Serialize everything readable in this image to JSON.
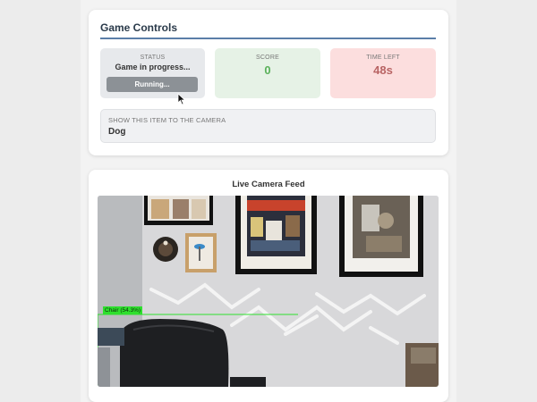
{
  "game_controls": {
    "title": "Game Controls",
    "status": {
      "label": "STATUS",
      "value": "Game in progress...",
      "button_label": "Running..."
    },
    "score": {
      "label": "SCORE",
      "value": "0"
    },
    "time_left": {
      "label": "TIME LEFT",
      "value": "48s"
    },
    "target_item": {
      "label": "SHOW THIS ITEM TO THE CAMERA",
      "value": "Dog"
    }
  },
  "camera_feed": {
    "title": "Live Camera Feed",
    "detection_label": "Chair (54.3%)"
  },
  "colors": {
    "accent_rule": "#5b7ea8",
    "score_green": "#5ab15a",
    "time_red": "#b86464",
    "detection_green": "#2ee02e"
  }
}
